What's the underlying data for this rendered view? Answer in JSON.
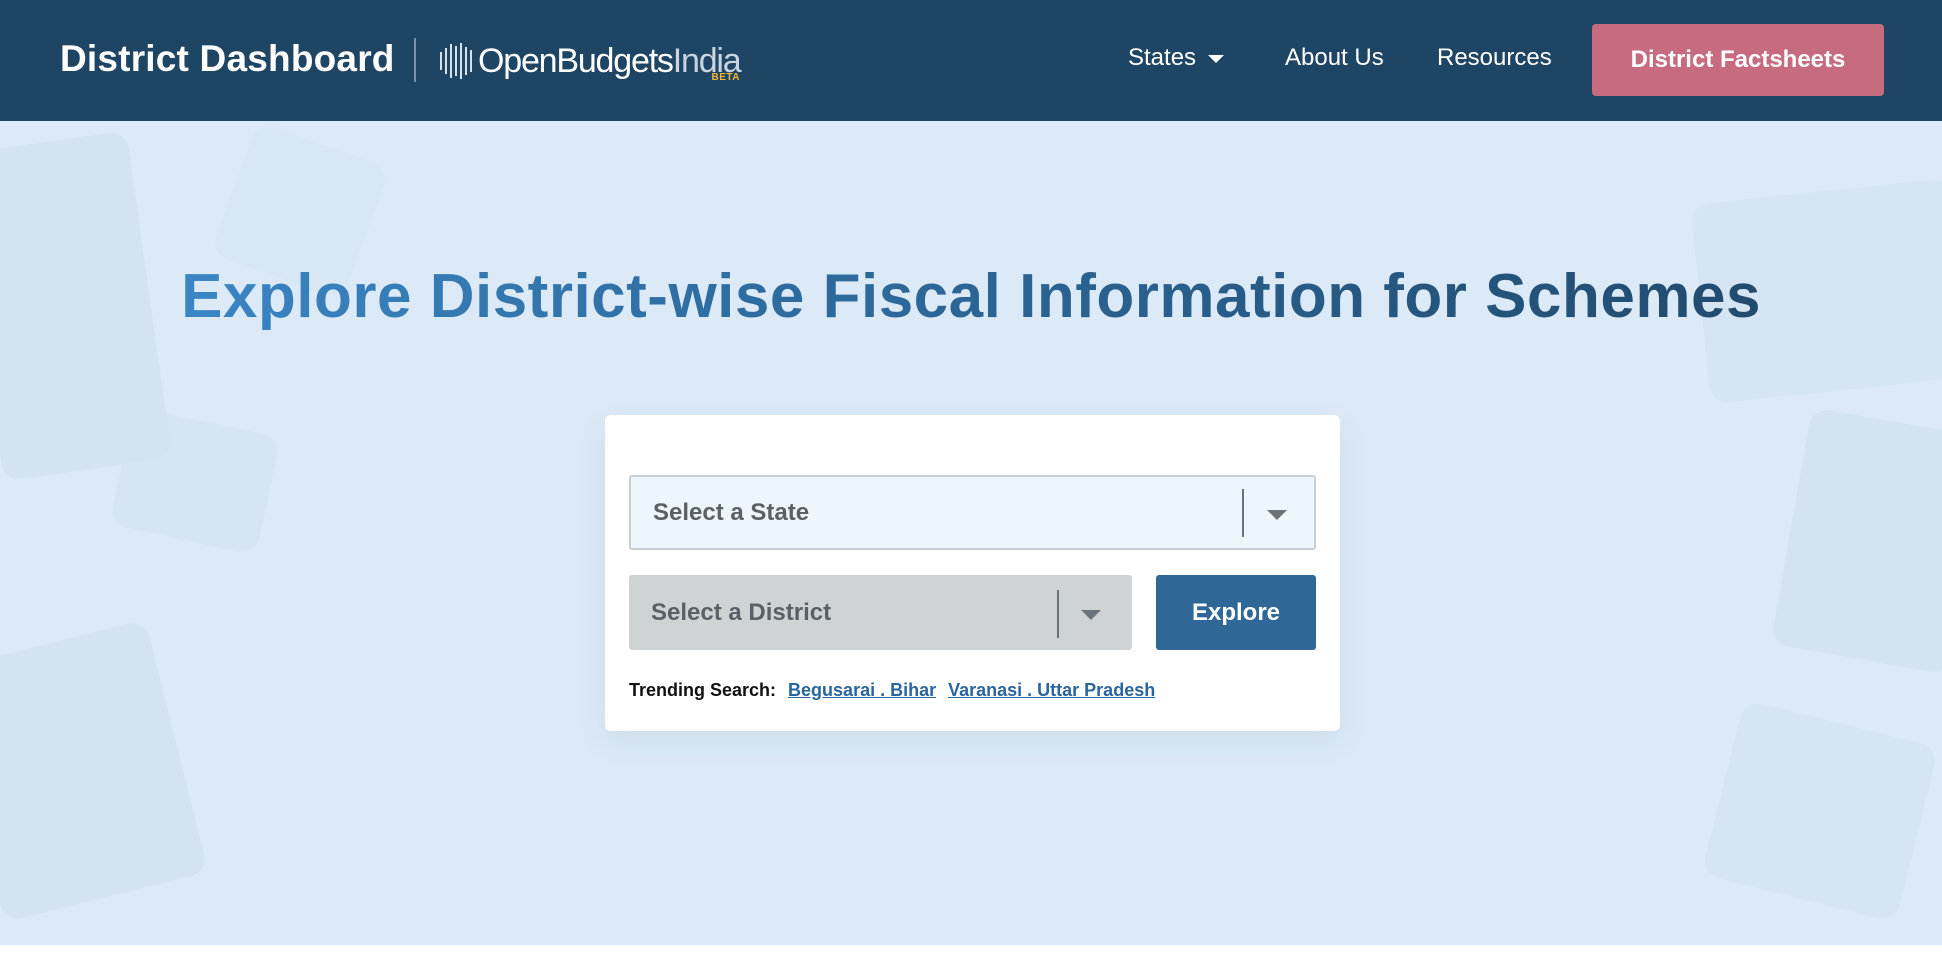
{
  "header": {
    "title": "District Dashboard",
    "logo": {
      "name": "Open Budgets India",
      "text_open_budgets": "OpenBudgets",
      "text_india": "India",
      "badge": "BETA"
    },
    "nav": {
      "states_label": "States",
      "about_label": "About Us",
      "resources_label": "Resources"
    },
    "cta_label": "District Factsheets"
  },
  "hero": {
    "title": "Explore District-wise Fiscal Information for Schemes"
  },
  "search": {
    "state_placeholder": "Select a State",
    "district_placeholder": "Select a District",
    "explore_label": "Explore",
    "trending_label": "Trending Search:",
    "trending": [
      "Begusarai . Bihar",
      "Varanasi . Uttar Pradesh"
    ]
  },
  "colors": {
    "header_bg": "#1f4565",
    "cta_bg": "#c76b7e",
    "hero_bg": "#dceaf7",
    "explore_bg": "#2f6796",
    "link": "#2a65a0"
  },
  "icons": [
    "states-dropdown-caret-icon",
    "state-select-chevron-icon",
    "district-select-chevron-icon",
    "obi-bars-logo-icon"
  ]
}
